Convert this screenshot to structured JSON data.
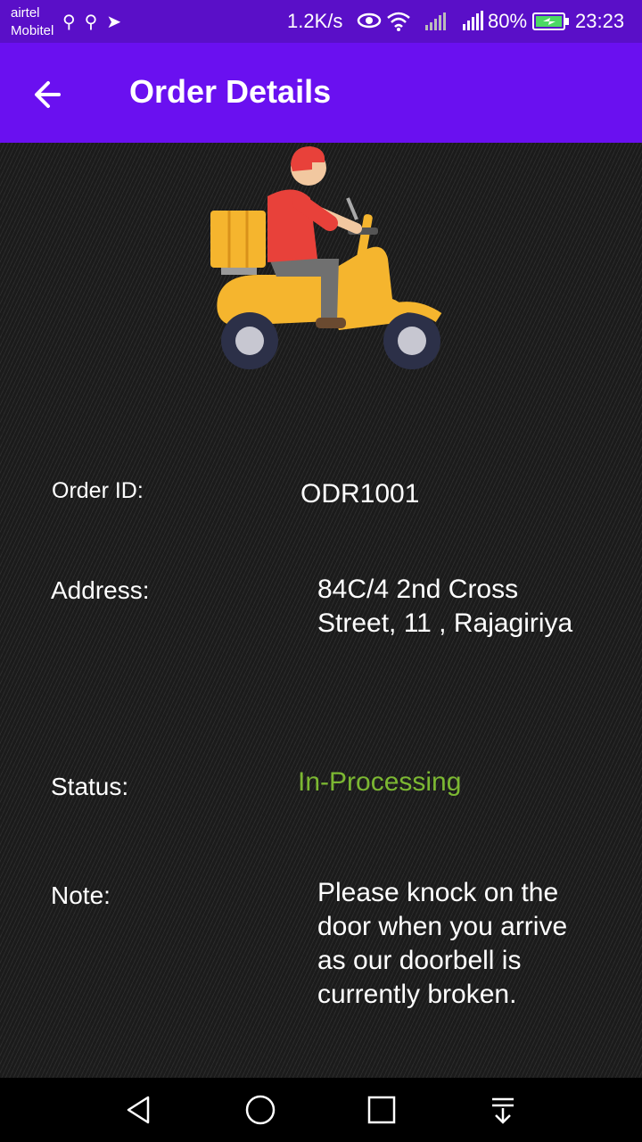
{
  "status_bar": {
    "carrier_1": "airtel",
    "carrier_2": "Mobitel",
    "net_speed": "1.2K/s",
    "battery": "80%",
    "time": "23:23",
    "icons": [
      "usb-icon",
      "usb-icon",
      "telegram-icon",
      "eye-icon",
      "wifi-icon",
      "signal-icon",
      "signal-icon",
      "battery-charging-icon"
    ]
  },
  "app_bar": {
    "title": "Order Details",
    "back_icon": "arrow-left-icon",
    "color": "#6a10f0"
  },
  "order": {
    "order_id_label": "Order ID:",
    "order_id": "ODR1001",
    "address_label": "Address:",
    "address_line1": "84C/4 2nd Cross",
    "address_line2": "Street, 11 , Rajagiriya",
    "status_label": "Status:",
    "status": "In-Processing",
    "status_color": "#7cb832",
    "note_label": "Note:",
    "note_line1": "Please knock on the",
    "note_line2": "door when you arrive",
    "note_line3": "as our doorbell is",
    "note_line4": "currently broken."
  },
  "illustration": "delivery-scooter-illustration",
  "nav_bar": {
    "buttons": [
      "back-triangle-icon",
      "home-circle-icon",
      "recents-square-icon",
      "notification-pull-icon"
    ]
  }
}
